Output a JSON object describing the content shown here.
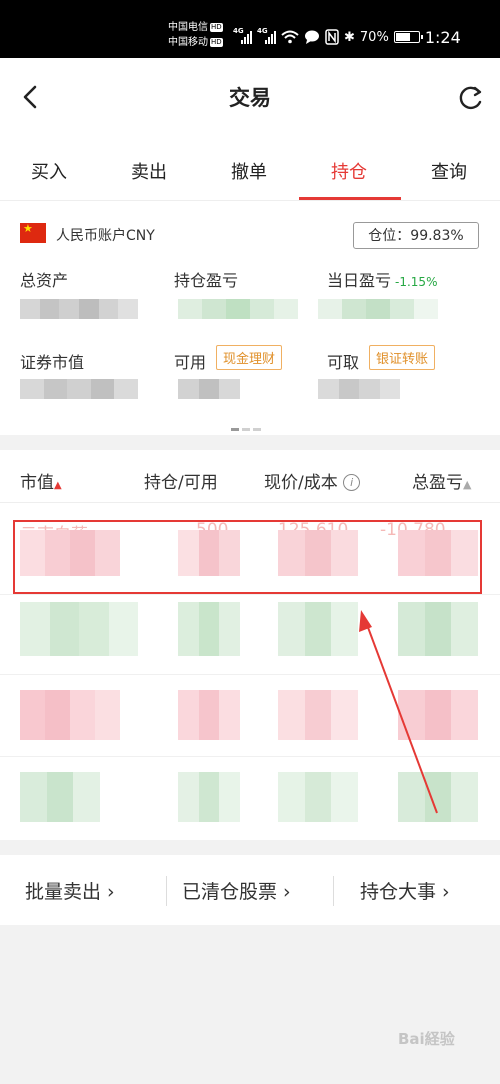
{
  "status_bar": {
    "carrier1": "中国电信",
    "carrier2": "中国移动",
    "hd": "HD",
    "net1": "4G",
    "net2": "4G",
    "battery": "70%",
    "battery_level": 0.7,
    "time": "1:24"
  },
  "nav": {
    "title": "交易"
  },
  "tabs": [
    {
      "label": "买入",
      "active": false
    },
    {
      "label": "卖出",
      "active": false
    },
    {
      "label": "撤单",
      "active": false
    },
    {
      "label": "持仓",
      "active": true
    },
    {
      "label": "查询",
      "active": false
    }
  ],
  "account": {
    "name": "人民币账户CNY",
    "position_ratio": "仓位：99.83%",
    "total_assets_label": "总资产",
    "holding_pnl_label": "持仓盈亏",
    "daily_pnl_label": "当日盈亏",
    "daily_pnl_pct": "-1.15%",
    "market_value_label": "证券市值",
    "available_label": "可用",
    "cash_mgmt_tag": "现金理财",
    "withdrawable_label": "可取",
    "transfer_tag": "银证转账"
  },
  "holdings": {
    "headers": {
      "market_value": "市值",
      "position": "持仓/可用",
      "price_cost": "现价/成本",
      "total_pnl": "总盈亏"
    },
    "visible_fragments": [
      "云南白药",
      "500",
      "125.610",
      "-10,780"
    ]
  },
  "bottom": {
    "batch_sell": "批量卖出 ›",
    "cleared": "已清仓股票 ›",
    "events": "持仓大事 ›"
  },
  "colors": {
    "accent": "#e53935",
    "gain": "#27a844",
    "tag": "#e0902a",
    "blur_red": "#f8c9cf",
    "blur_green": "#c9e8cc",
    "blur_gray": "#c4c4c4"
  }
}
